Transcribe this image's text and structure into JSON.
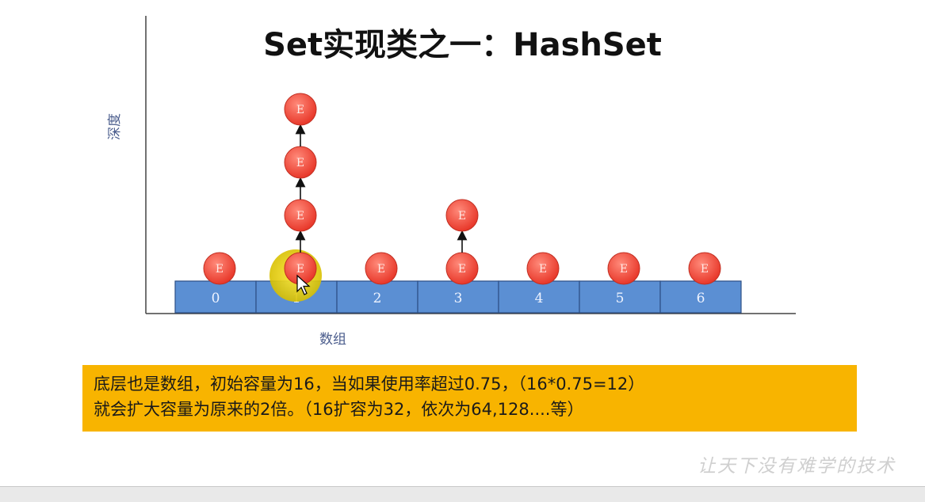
{
  "slide": {
    "title": "Set实现类之一：HashSet",
    "watermark": "让天下没有难学的技术"
  },
  "diagram": {
    "y_axis_label": "深度",
    "x_axis_label": "数组",
    "buckets": [
      {
        "index": "0",
        "chain": [
          "E"
        ]
      },
      {
        "index": "1",
        "chain": [
          "E",
          "E",
          "E",
          "E"
        ]
      },
      {
        "index": "2",
        "chain": [
          "E"
        ]
      },
      {
        "index": "3",
        "chain": [
          "E",
          "E"
        ]
      },
      {
        "index": "4",
        "chain": [
          "E"
        ]
      },
      {
        "index": "5",
        "chain": [
          "E"
        ]
      },
      {
        "index": "6",
        "chain": [
          "E"
        ]
      }
    ],
    "colors": {
      "node": "#f04a3c",
      "bucket": "#5b8fd3",
      "highlight": "#e8d400"
    }
  },
  "caption": {
    "line1": "底层也是数组，初始容量为16，当如果使用率超过0.75，（16*0.75=12）",
    "line2": "就会扩大容量为原来的2倍。（16扩容为32，依次为64,128....等）"
  }
}
